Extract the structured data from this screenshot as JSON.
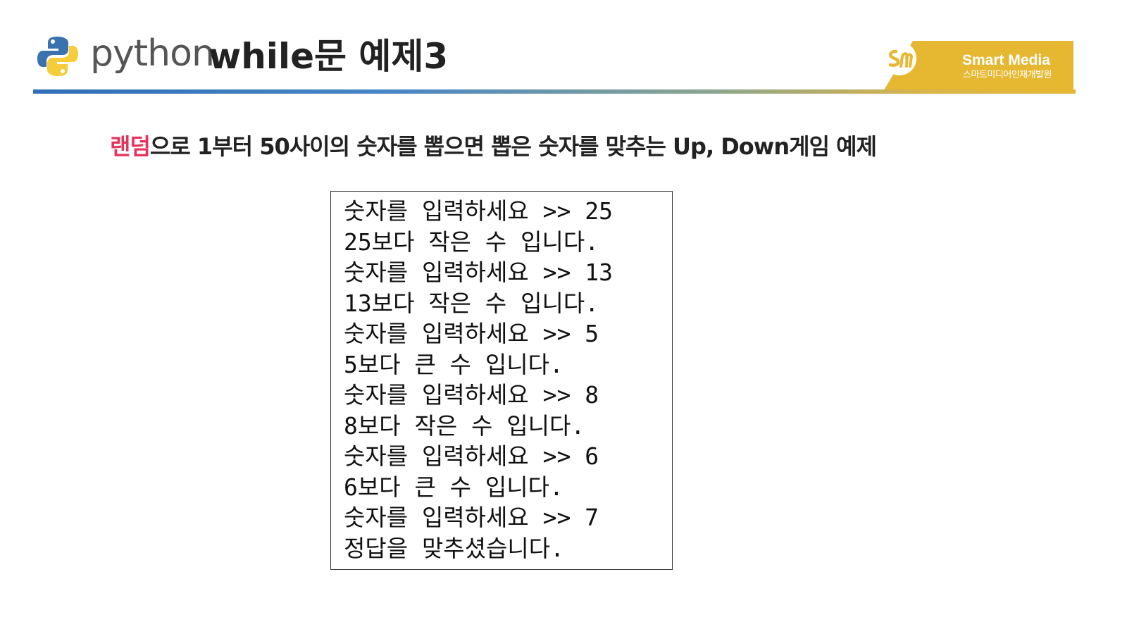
{
  "header": {
    "logo_word": "python",
    "title": "while문 예제3"
  },
  "brand": {
    "mark": "Sm",
    "name": "Smart Media",
    "subtitle": "스마트미디어인재개발원"
  },
  "subtitle": {
    "highlight": "랜덤",
    "rest": "으로 1부터 50사이의 숫자를 뽑으면 뽑은 숫자를 맞추는 Up, Down게임 예제"
  },
  "colors": {
    "highlight": "#e8315b",
    "python_blue": "#3a72b0",
    "python_yellow": "#f5cd3b",
    "brand_gold": "#e6b832"
  },
  "console": {
    "lines": [
      "숫자를 입력하세요 >> 25",
      "25보다 작은 수 입니다.",
      "숫자를 입력하세요 >> 13",
      "13보다 작은 수 입니다.",
      "숫자를 입력하세요 >> 5",
      "5보다 큰 수 입니다.",
      "숫자를 입력하세요 >> 8",
      "8보다 작은 수 입니다.",
      "숫자를 입력하세요 >> 6",
      "6보다 큰 수 입니다.",
      "숫자를 입력하세요 >> 7",
      "정답을 맞추셨습니다."
    ]
  },
  "icons": {
    "logo": "python-logo-icon",
    "brand": "smart-media-logo-icon"
  }
}
